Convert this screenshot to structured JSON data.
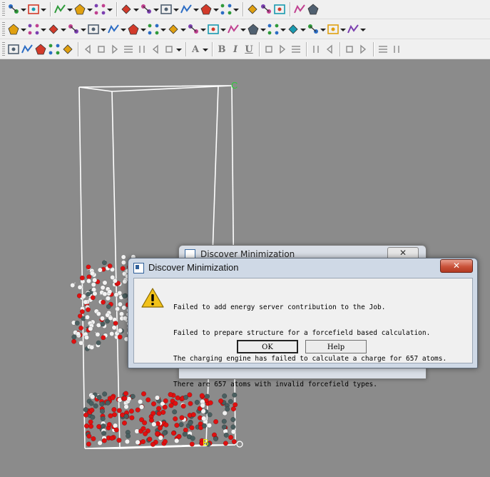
{
  "toolbar": {
    "row1_icons": [
      "select-arrow-icon",
      "sketch-pencil-icon",
      "sketch-atom-icon",
      "sketch-ring-icon",
      "adjust-hydrogen-icon",
      "clean-icon",
      "ruler-icon",
      "measure-icon",
      "display-style-icon",
      "label-icon",
      "color-icon",
      "crystal-build-icon",
      "build-cell-icon",
      "rotate-icon",
      "zoom-icon",
      "reset-view-icon"
    ],
    "row2_icons": [
      "modules-icon",
      "forcite-icon",
      "castep-icon",
      "dmol3-icon",
      "amorphous-cell-icon",
      "sorption-icon",
      "blends-icon",
      "conformers-icon",
      "equilibria-icon",
      "mesodyn-icon",
      "polymorph-icon",
      "reflex-icon",
      "qsar-icon",
      "synthia-icon",
      "visualizer-icon",
      "gulp-icon",
      "discover-icon",
      "dpd-icon"
    ],
    "row3_icons": [
      "atom-display-icon",
      "bond-icon",
      "ball-stick-icon",
      "group-icon",
      "table-icon",
      "first-frame-icon",
      "prev-frame-icon",
      "stop-icon",
      "play-icon",
      "next-frame-icon",
      "pause-icon",
      "move-icon",
      "font-color-icon",
      "bold-icon",
      "italic-icon",
      "underline-icon",
      "align-left-icon",
      "align-center-icon",
      "align-right-icon",
      "indent-icon",
      "outdent-icon",
      "numbered-list-icon",
      "bullet-list-icon",
      "insert-image-icon",
      "insert-object-icon"
    ],
    "text_glyphs": {
      "font": "A",
      "bold": "B",
      "italic": "I",
      "underline": "U"
    }
  },
  "viewport": {
    "axis_labels": {
      "c": "C",
      "b": "B",
      "a": "A"
    },
    "colors": {
      "background": "#8b8b8b",
      "cell_edges": "#ffffff",
      "oxygen": "#e01010",
      "hydrogen": "#f2f2f2",
      "carbon": "#4a5f60",
      "axis_c": "#2ecc3a",
      "axis_b": "#f0f000",
      "axis_a": "#ff3030"
    }
  },
  "background_dialog": {
    "title": "Discover Minimization",
    "close_glyph": "✕"
  },
  "dialog": {
    "title": "Discover Minimization",
    "close_glyph": "✕",
    "icon": "warning-icon",
    "message_lines": [
      "Failed to add energy server contribution to the Job.",
      "Failed to prepare structure for a forcefield based calculation.",
      "The charging engine has failed to calculate a charge for 657 atoms.",
      "There are 657 atoms with invalid forcefield types."
    ],
    "buttons": {
      "ok": "OK",
      "help": "Help"
    }
  }
}
